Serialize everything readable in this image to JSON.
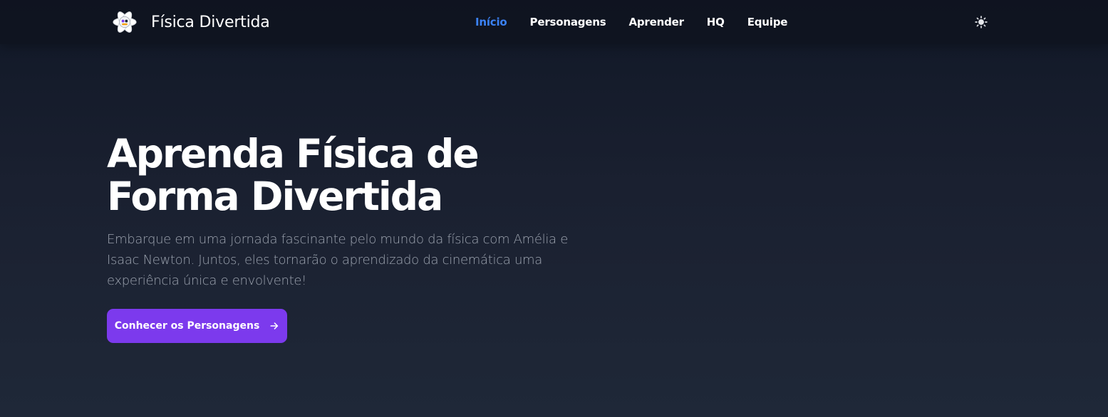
{
  "brand": {
    "logo_icon": "atom-logo-icon",
    "name": "Física Divertida"
  },
  "nav": {
    "items": [
      {
        "label": "Início",
        "active": true
      },
      {
        "label": "Personagens",
        "active": false
      },
      {
        "label": "Aprender",
        "active": false
      },
      {
        "label": "HQ",
        "active": false
      },
      {
        "label": "Equipe",
        "active": false
      }
    ],
    "theme_toggle_icon": "sun-icon"
  },
  "hero": {
    "title_line1": "Aprenda Física de",
    "title_line2": "Forma Divertida",
    "subtitle": "Embarque em uma jornada fascinante pelo mundo da física com Amélia e Isaac Newton. Juntos, eles tornarão o aprendizado da cinemática uma experiência única e envolvente!",
    "cta_label": "Conhecer os Personagens",
    "cta_icon": "arrow-right-icon"
  },
  "colors": {
    "background": "#111827",
    "nav_active": "#3b82f6",
    "cta": "#7c3aed",
    "subtitle": "#9ca3af"
  }
}
